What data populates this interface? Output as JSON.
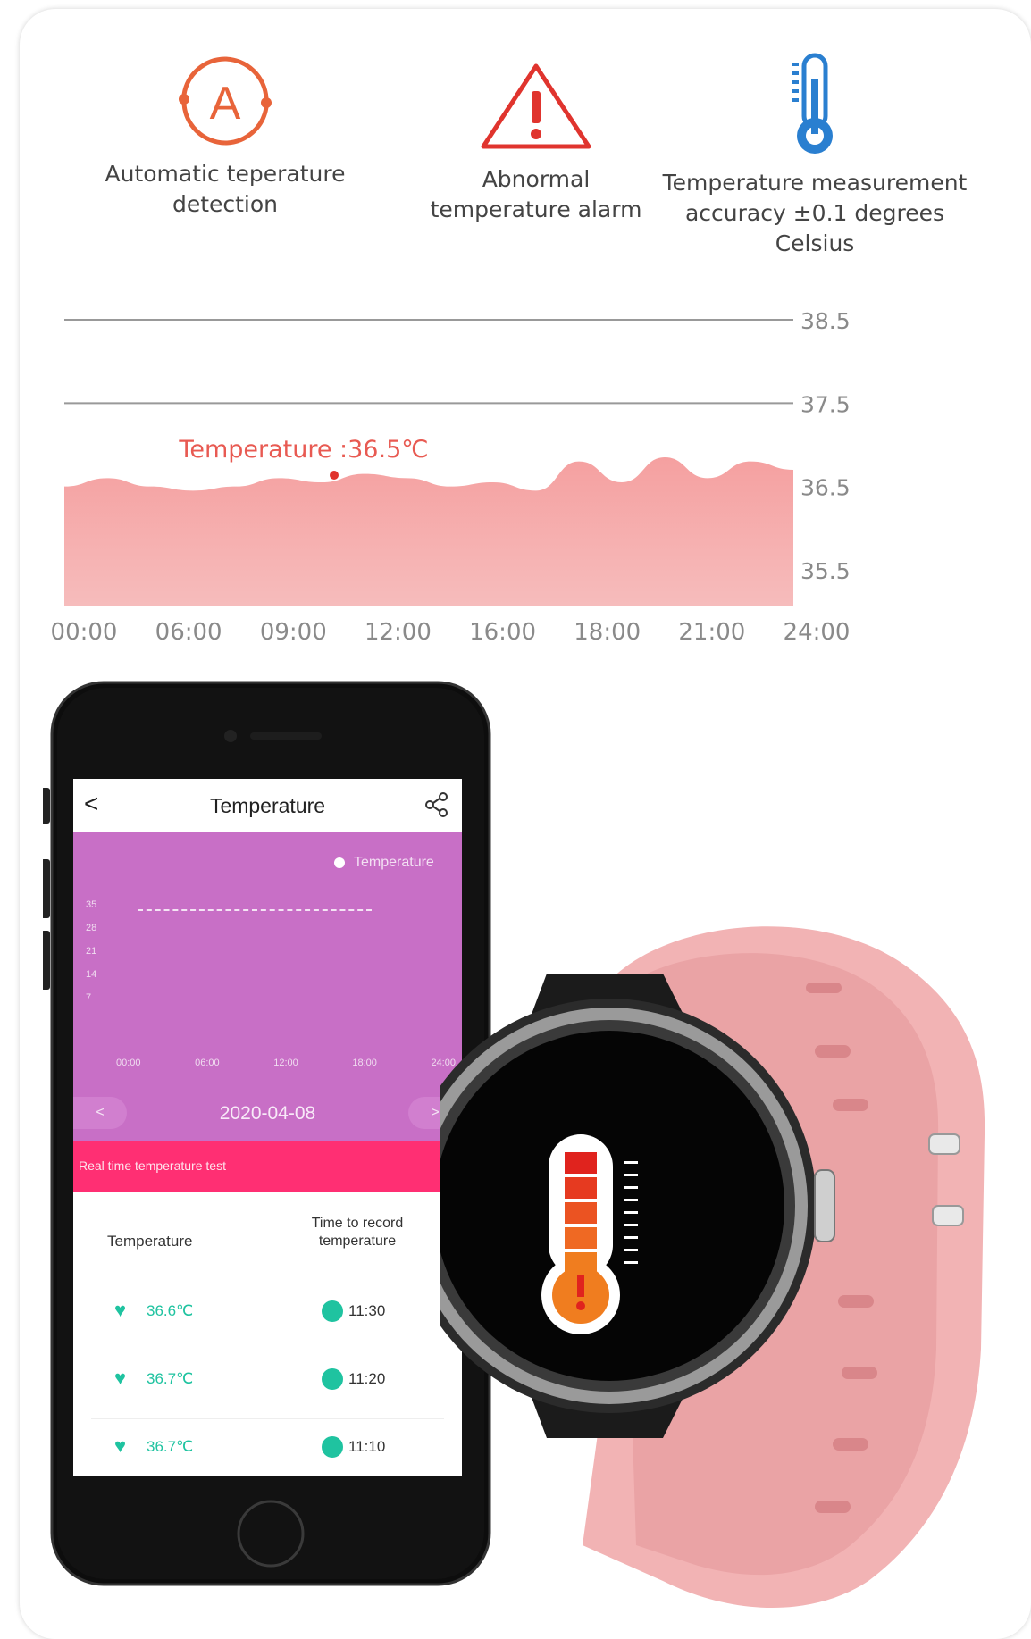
{
  "features": [
    {
      "icon": "auto-detect-icon",
      "label": "Automatic teperature\ndetection"
    },
    {
      "icon": "warning-icon",
      "label": "Abnormal\ntemperature alarm"
    },
    {
      "icon": "thermometer-icon",
      "label": "Temperature measurement\naccuracy ±0.1 degrees\nCelsius"
    }
  ],
  "colors": {
    "accent": "#e8643a",
    "alarm": "#e0342e",
    "thermo": "#2a7fd0",
    "area": "#f5a0a0",
    "app_chart": "#c86fc6",
    "app_bar": "#ff2f73",
    "teal": "#1fc3a0"
  },
  "chart_data": {
    "type": "area",
    "title": "",
    "xlabel": "",
    "ylabel": "",
    "x": [
      "00:00",
      "06:00",
      "09:00",
      "12:00",
      "16:00",
      "18:00",
      "21:00",
      "24:00"
    ],
    "y_ticks": [
      38.5,
      37.5,
      36.5,
      35.5
    ],
    "ylim": [
      35.0,
      38.5
    ],
    "series": [
      {
        "values": [
          36.5,
          36.6,
          36.5,
          36.45,
          36.5,
          36.6,
          36.55,
          36.65,
          36.6,
          36.5,
          36.55,
          36.45,
          36.8,
          36.55,
          36.85,
          36.6,
          36.8,
          36.7
        ]
      }
    ],
    "annotation": {
      "text": "Temperature :36.5℃",
      "x_index": 6
    },
    "grid": true,
    "legend": "none"
  },
  "app": {
    "title": "Temperature",
    "back": "<",
    "legend_label": "Temperature",
    "y_ticks": [
      "35",
      "28",
      "21",
      "14",
      "7"
    ],
    "x_ticks": [
      "00:00",
      "06:00",
      "12:00",
      "18:00",
      "24:00"
    ],
    "date": "2020-04-08",
    "prev": "<",
    "next": ">",
    "bar_label": "Real time temperature test",
    "col_temp": "Temperature",
    "col_time": "Time to record temperature",
    "rows": [
      {
        "temp": "36.6℃",
        "time": "11:30"
      },
      {
        "temp": "36.7℃",
        "time": "11:20"
      },
      {
        "temp": "36.7℃",
        "time": "11:10"
      }
    ]
  }
}
